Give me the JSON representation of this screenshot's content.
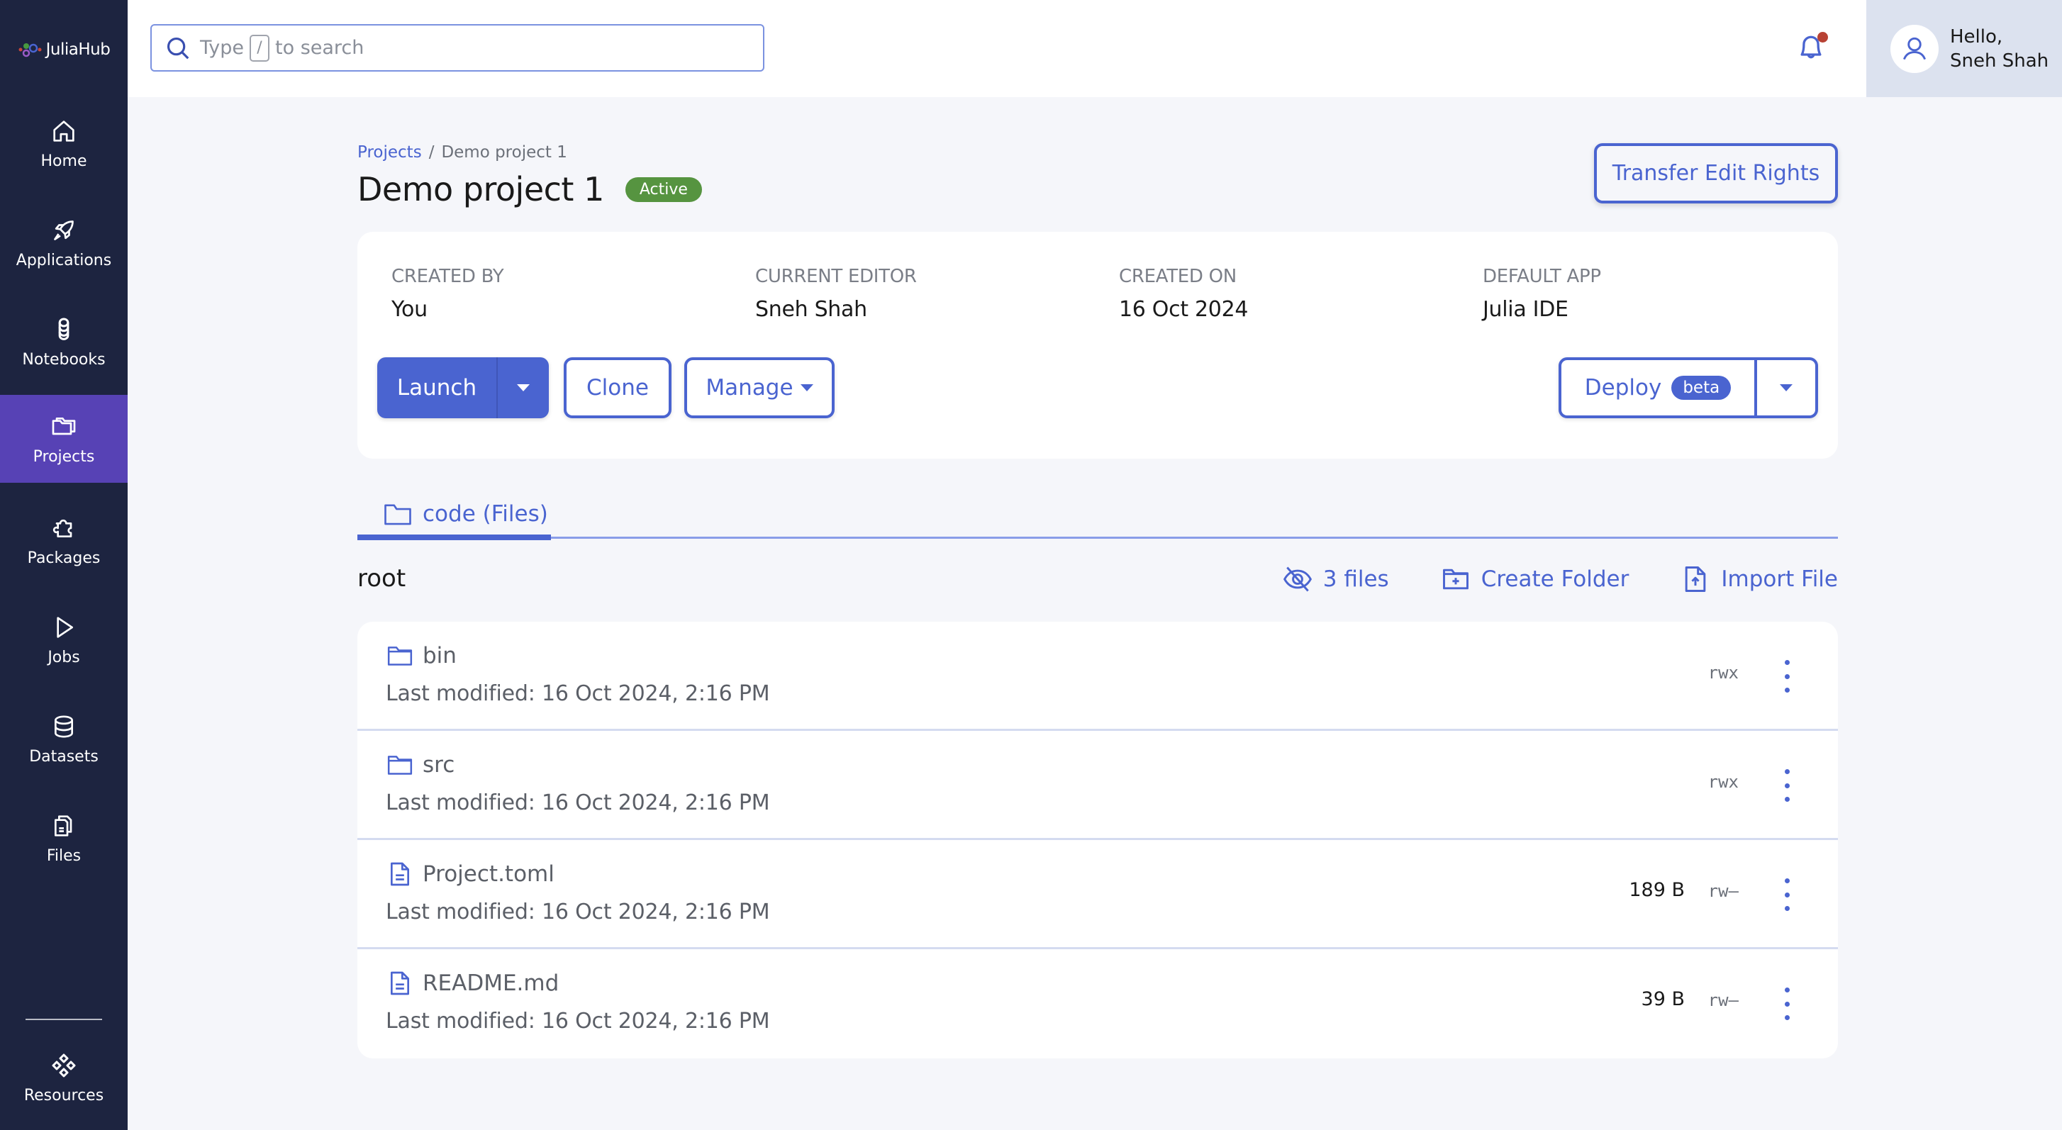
{
  "app": {
    "brand": "JuliaHub",
    "accent_color": "#4a64d0",
    "sidebar_bg": "#1d2440",
    "sidebar_active_bg": "#5742b5"
  },
  "sidebar": {
    "items": [
      {
        "label": "Home",
        "icon": "home-icon"
      },
      {
        "label": "Applications",
        "icon": "rocket-icon"
      },
      {
        "label": "Notebooks",
        "icon": "notebooks-icon"
      },
      {
        "label": "Projects",
        "icon": "folder-icon",
        "active": true
      },
      {
        "label": "Packages",
        "icon": "puzzle-icon"
      },
      {
        "label": "Jobs",
        "icon": "play-icon"
      },
      {
        "label": "Datasets",
        "icon": "database-icon"
      },
      {
        "label": "Files",
        "icon": "files-icon"
      }
    ],
    "bottom": {
      "label": "Resources",
      "icon": "resources-icon"
    }
  },
  "header": {
    "search": {
      "prefix": "Type",
      "key": "/",
      "suffix": "to search"
    },
    "notifications": {
      "has_unread": true
    },
    "user": {
      "greeting": "Hello,",
      "name": "Sneh Shah"
    }
  },
  "breadcrumb": {
    "parent": "Projects",
    "separator": "/",
    "current": "Demo project 1"
  },
  "project": {
    "title": "Demo project 1",
    "status": "Active",
    "status_color": "#569440",
    "transfer_label": "Transfer Edit Rights",
    "info": [
      {
        "label": "CREATED BY",
        "value": "You"
      },
      {
        "label": "CURRENT EDITOR",
        "value": "Sneh Shah"
      },
      {
        "label": "CREATED ON",
        "value": "16 Oct 2024"
      },
      {
        "label": "DEFAULT APP",
        "value": "Julia IDE"
      }
    ],
    "actions": {
      "launch": "Launch",
      "clone": "Clone",
      "manage": "Manage",
      "deploy": "Deploy",
      "deploy_badge": "beta"
    }
  },
  "tabs": [
    {
      "label": "code (Files)",
      "active": true
    }
  ],
  "files": {
    "path": "root",
    "toolbar": {
      "hidden_count": "3 files",
      "create_folder": "Create Folder",
      "import_file": "Import File"
    },
    "items": [
      {
        "type": "folder",
        "name": "bin",
        "modified": "Last modified: 16 Oct 2024, 2:16 PM",
        "size": "",
        "perms": "rwx"
      },
      {
        "type": "folder",
        "name": "src",
        "modified": "Last modified: 16 Oct 2024, 2:16 PM",
        "size": "",
        "perms": "rwx"
      },
      {
        "type": "file",
        "name": "Project.toml",
        "modified": "Last modified: 16 Oct 2024, 2:16 PM",
        "size": "189 B",
        "perms": "rw–"
      },
      {
        "type": "file",
        "name": "README.md",
        "modified": "Last modified: 16 Oct 2024, 2:16 PM",
        "size": "39 B",
        "perms": "rw–"
      }
    ]
  }
}
